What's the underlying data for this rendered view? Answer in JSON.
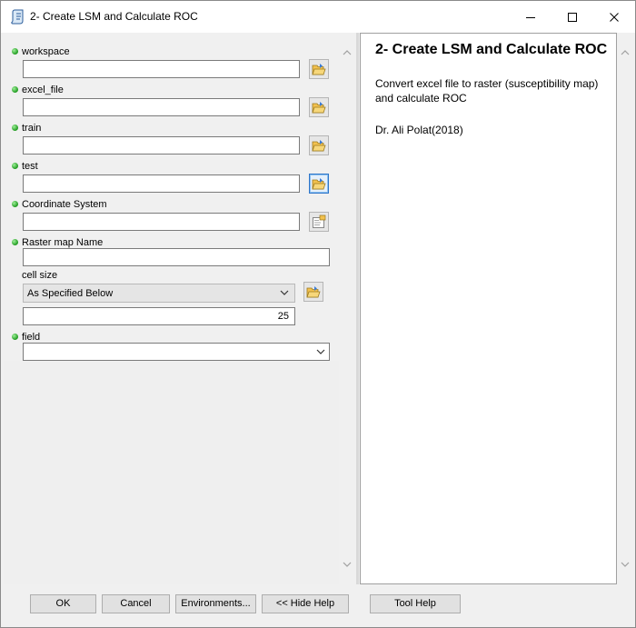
{
  "window": {
    "title": "2- Create LSM and Calculate ROC",
    "icon": "script-tool-icon",
    "controls": [
      "minimize",
      "maximize",
      "close"
    ]
  },
  "parameters": {
    "workspace": {
      "label": "workspace",
      "value": "",
      "required": true
    },
    "excel_file": {
      "label": "excel_file",
      "value": "",
      "required": true
    },
    "train": {
      "label": "train",
      "value": "",
      "required": true
    },
    "test": {
      "label": "test",
      "value": "",
      "required": true
    },
    "coordinate_system": {
      "label": "Coordinate System",
      "value": "",
      "required": true
    },
    "raster_map_name": {
      "label": "Raster map Name",
      "value": "",
      "required": true
    },
    "cell_size": {
      "label": "cell size",
      "selected": "As Specified Below",
      "value": "25"
    },
    "field": {
      "label": "field",
      "value": "",
      "required": true
    }
  },
  "help": {
    "title": "2- Create LSM and Calculate ROC",
    "description": "Convert excel file to raster (susceptibility map) and calculate ROC",
    "author": "Dr. Ali Polat(2018)"
  },
  "buttons": {
    "ok": "OK",
    "cancel": "Cancel",
    "environments": "Environments...",
    "hide_help": "<< Hide Help",
    "tool_help": "Tool Help"
  },
  "colors": {
    "required_dot": "#1f9a1f",
    "focus_border": "#2f76c9"
  }
}
